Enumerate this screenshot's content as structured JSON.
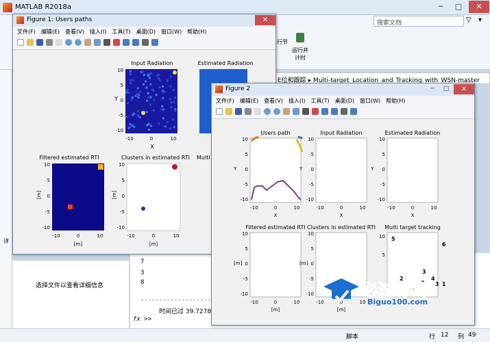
{
  "main_window": {
    "title": "MATLAB R2018a"
  },
  "toolbar": {
    "run_section_label": "行节",
    "run_advance_label": "运行并\n计时"
  },
  "search": {
    "placeholder": "搜索文档"
  },
  "path_bar": {
    "prefix": "E位和跟踪",
    "folder": "Multi-target_Location_and_Tracking_with_WSN-master"
  },
  "details_panel": {
    "label": "详",
    "message": "选择文件以查看详细信息"
  },
  "command_window": {
    "lines": [
      "7",
      "3",
      "8"
    ],
    "dashes": "-----------------------------------------------",
    "elapsed": "时间已过 39.727822 秒。",
    "prompt": "fx >>"
  },
  "status_bar": {
    "mode": "脚本",
    "row_label": "行",
    "row": "12",
    "col_label": "列",
    "col": "49"
  },
  "figure1": {
    "title": "Figure 1: Users paths",
    "menu": [
      "文件(F)",
      "编辑(E)",
      "查看(V)",
      "插入(I)",
      "工具(T)",
      "桌面(D)",
      "窗口(W)",
      "帮助(H)"
    ],
    "plots": {
      "input_radiation": {
        "title": "Input Radiation",
        "xlabel": "X",
        "ylabel": "Y"
      },
      "estimated_radiation": {
        "title": "Estimated Radiation"
      },
      "filtered_rti": {
        "title": "Filtered estimated RTI",
        "xlabel": "[m]",
        "ylabel": "[m]"
      },
      "clusters": {
        "title": "Clusters in estimated RTI",
        "xlabel": "[m]",
        "ylabel": "[m]"
      },
      "multi": {
        "title": "Multi"
      }
    },
    "ticks": {
      "y": [
        "10",
        "5",
        "0",
        "-5",
        "-10"
      ],
      "x": [
        "-10",
        "0",
        "10"
      ]
    }
  },
  "figure2": {
    "title": "Figure 2",
    "menu": [
      "文件(F)",
      "编辑(E)",
      "查看(V)",
      "插入(I)",
      "工具(T)",
      "桌面(D)",
      "窗口(W)",
      "帮助(H)"
    ],
    "plots": {
      "users_path": {
        "title": "Users path",
        "xlabel": "X",
        "ylabel": "Y"
      },
      "input_radiation": {
        "title": "Input Radiation",
        "xlabel": "X",
        "ylabel": "Y"
      },
      "estimated_radiation": {
        "title": "Estimated Radiation",
        "xlabel": "X",
        "ylabel": "Y"
      },
      "filtered_rti": {
        "title": "Filtered estimated RTI",
        "xlabel": "[m]",
        "ylabel": "[m]"
      },
      "clusters": {
        "title": "Clusters in estimated RTI",
        "xlabel": "[m]",
        "ylabel": "[m]"
      },
      "tracking": {
        "title": "Multi target tracking",
        "labels": [
          "5",
          "3",
          "4",
          "6",
          "1",
          "2",
          "3"
        ]
      }
    },
    "ticks": {
      "y": [
        "10",
        "5",
        "0",
        "-5",
        "-10"
      ],
      "x": [
        "-10",
        "0",
        "10"
      ]
    }
  },
  "watermark": {
    "text": "必过源码",
    "url": "Biguo100.com"
  },
  "colors": {
    "accent": "#2f5a8a",
    "path": "#7b3f8c",
    "heat_bg": "#1a1aa0"
  }
}
